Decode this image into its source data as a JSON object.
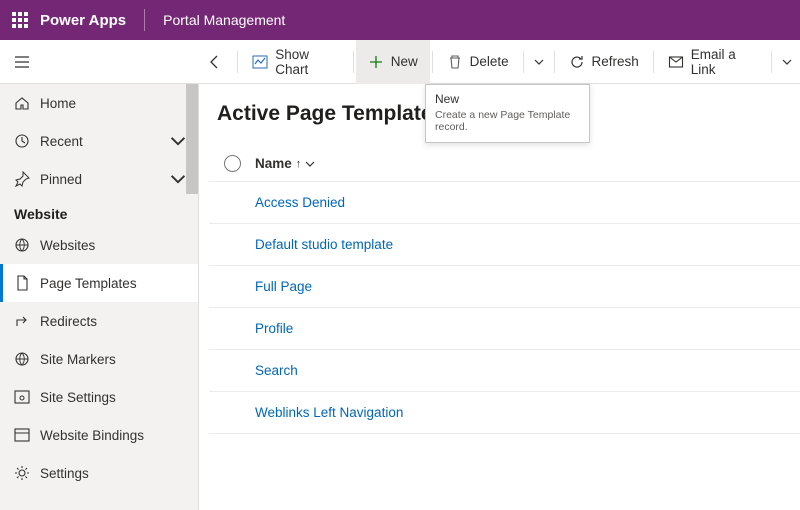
{
  "header": {
    "app_name": "Power Apps",
    "module": "Portal Management"
  },
  "commandbar": {
    "back": "",
    "show_chart": "Show Chart",
    "new": "New",
    "delete": "Delete",
    "refresh": "Refresh",
    "email_link": "Email a Link"
  },
  "tooltip": {
    "title": "New",
    "desc": "Create a new Page Template record."
  },
  "sidebar": {
    "home": "Home",
    "recent": "Recent",
    "pinned": "Pinned",
    "group_website": "Website",
    "websites": "Websites",
    "page_templates": "Page Templates",
    "redirects": "Redirects",
    "site_markers": "Site Markers",
    "site_settings": "Site Settings",
    "website_bindings": "Website Bindings",
    "settings": "Settings"
  },
  "view": {
    "title": "Active Page Templates",
    "column_name": "Name"
  },
  "rows": [
    {
      "name": "Access Denied"
    },
    {
      "name": "Default studio template"
    },
    {
      "name": "Full Page"
    },
    {
      "name": "Profile"
    },
    {
      "name": "Search"
    },
    {
      "name": "Weblinks Left Navigation"
    }
  ],
  "colors": {
    "brand": "#742774",
    "link": "#0066b8",
    "accent": "#0078d4"
  }
}
